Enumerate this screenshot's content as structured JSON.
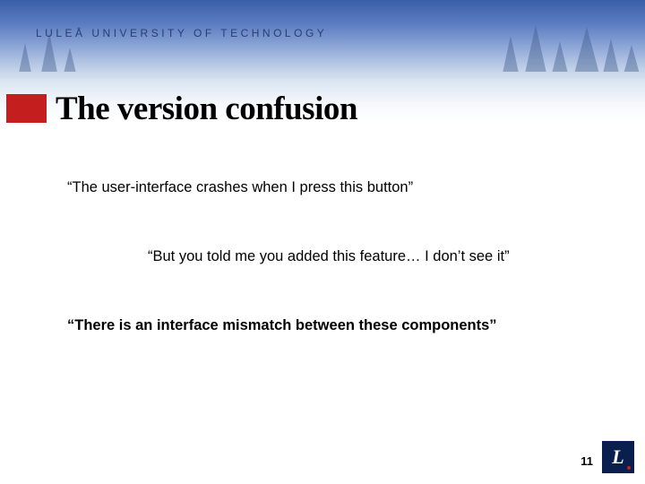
{
  "header": {
    "university": "LULEÅ UNIVERSITY OF TECHNOLOGY"
  },
  "slide": {
    "title": "The version confusion",
    "quotes": [
      "“The user-interface crashes when I press this button”",
      "“But you told me you added this feature… I don’t see it”",
      "“There is an interface mismatch between these components”"
    ]
  },
  "footer": {
    "page_number": "11",
    "logo_letter": "L"
  }
}
